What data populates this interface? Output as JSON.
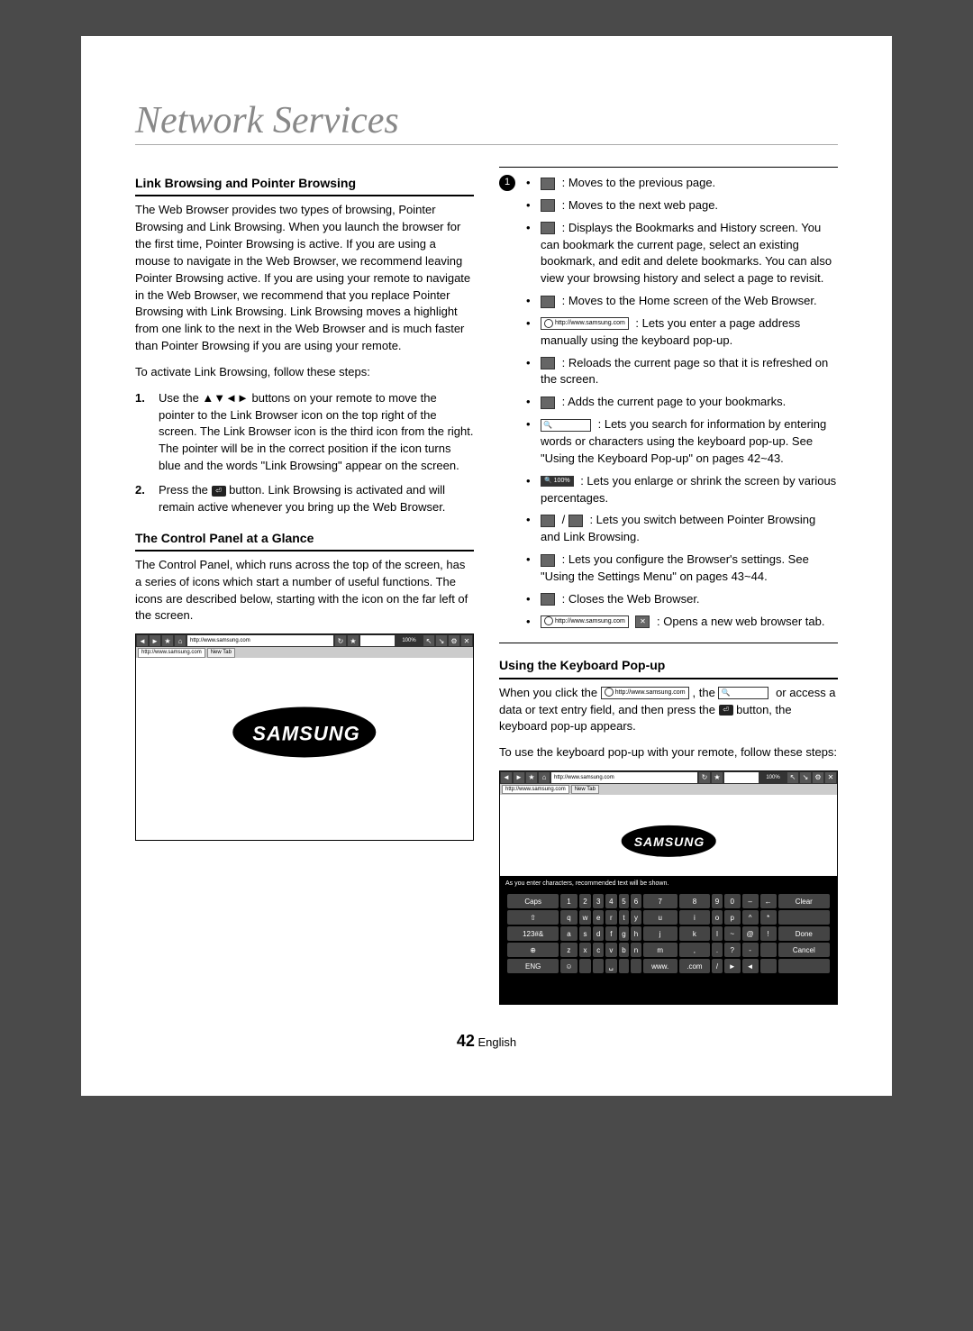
{
  "title": "Network Services",
  "left": {
    "subhead1": "Link Browsing and Pointer Browsing",
    "p1": "The Web Browser provides two types of browsing, Pointer Browsing and Link Browsing. When you launch the browser for the first time, Pointer Browsing is active. If you are using a mouse to navigate in the Web Browser, we recommend leaving Pointer Browsing active. If you are using your remote to navigate in the Web Browser, we recommend that you replace Pointer Browsing with Link Browsing. Link Browsing moves a highlight from one link to the next in the Web Browser and is much faster than Pointer Browsing if you are using your remote.",
    "p2": "To activate Link Browsing, follow these steps:",
    "step1_num": "1.",
    "step1": "Use the ▲▼◄► buttons on your remote to move the pointer to the Link Browser icon on the top right of the screen. The Link Browser icon is the third icon from the right. The pointer will be in the correct position if the icon turns blue and the words \"Link Browsing\" appear on the screen.",
    "step2_num": "2.",
    "step2a": "Press the ",
    "step2b": " button. Link Browsing is activated and will remain active whenever you bring up the Web Browser.",
    "subhead2": "The Control Panel at a Glance",
    "p3": "The Control Panel, which runs across the top of the screen, has a series of icons which start a number of useful functions. The icons are described below, starting with the icon on the far left of the screen.",
    "browser_url": "http://www.samsung.com",
    "browser_tab": "http://www.samsung.com",
    "logo": "SAMSUNG"
  },
  "right": {
    "items": [
      {
        "icon": "box",
        "txt": " : Moves to the previous page."
      },
      {
        "icon": "box",
        "txt": " : Moves to the next web page."
      },
      {
        "icon": "box",
        "txt": " : Displays the Bookmarks and History screen. You can bookmark the current page, select an existing bookmark, and edit and delete bookmarks. You can also view your browsing history and select a page to revisit."
      },
      {
        "icon": "box",
        "txt": " : Moves to the Home screen of the Web Browser."
      },
      {
        "icon": "url",
        "label": "http://www.samsung.com",
        "txt": " : Lets you enter a page address manually using the keyboard pop-up."
      },
      {
        "icon": "box",
        "txt": " : Reloads the current page so that it is refreshed on the screen."
      },
      {
        "icon": "box",
        "txt": " : Adds the current page to your bookmarks."
      },
      {
        "icon": "search",
        "txt": " : Lets you search for information by entering words or characters using the keyboard pop-up. See \"Using the Keyboard Pop-up\" on pages 42~43."
      },
      {
        "icon": "zoom",
        "label": "🔍 100%",
        "txt": " : Lets you enlarge or shrink the screen by various percentages."
      },
      {
        "icon": "dual",
        "txt": " : Lets you switch between Pointer Browsing and Link Browsing."
      },
      {
        "icon": "box",
        "txt": " : Lets you configure the Browser's settings. See \"Using the Settings Menu\" on pages 43~44."
      },
      {
        "icon": "box",
        "txt": " : Closes the Web Browser."
      },
      {
        "icon": "newtab",
        "label": "http://www.samsung.com",
        "txt": " : Opens a new web browser tab."
      }
    ],
    "subhead3": "Using the Keyboard Pop-up",
    "kp1a": "When you click the ",
    "kp1b": ", the ",
    "kp1c": " or access a data or text entry field, and then press the ",
    "kp1d": " button, the keyboard pop-up appears.",
    "kp2": "To use the keyboard pop-up with your remote, follow these steps:",
    "kb_url": "http://www.samsung.com",
    "kb_hint": "As you enter characters, recommended text will be shown.",
    "kb_rows": [
      [
        "Caps",
        "1",
        "2",
        "3",
        "4",
        "5",
        "6",
        "7",
        "8",
        "9",
        "0",
        "–",
        "←",
        "Clear"
      ],
      [
        "⇧",
        "q",
        "w",
        "e",
        "r",
        "t",
        "y",
        "u",
        "i",
        "o",
        "p",
        "^",
        "*",
        ""
      ],
      [
        "123#&",
        "a",
        "s",
        "d",
        "f",
        "g",
        "h",
        "j",
        "k",
        "l",
        "~",
        "@",
        "!",
        "Done"
      ],
      [
        "⊕",
        "z",
        "x",
        "c",
        "v",
        "b",
        "n",
        "m",
        ",",
        ".",
        "?",
        "-",
        "",
        "Cancel"
      ],
      [
        "ENG",
        "☺",
        "",
        "",
        "␣",
        "",
        "",
        "www.",
        ".com",
        "/",
        "►",
        "◄",
        "",
        ""
      ]
    ],
    "url_label": "http://www.samsung.com"
  },
  "footer": {
    "page": "42",
    "lang": "English"
  }
}
